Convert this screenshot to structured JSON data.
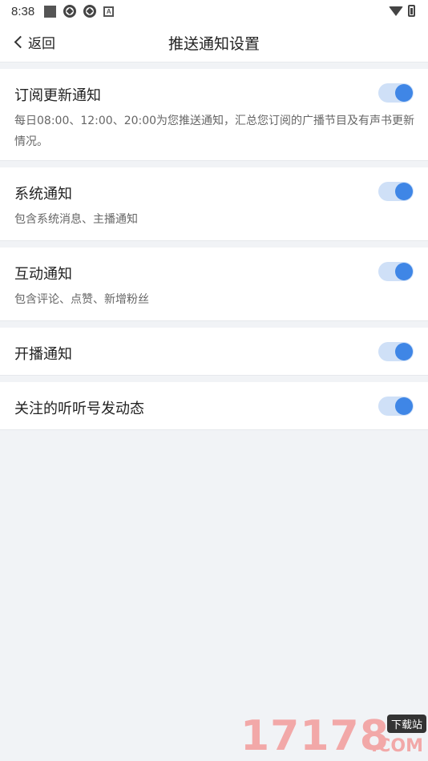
{
  "status_bar": {
    "time": "8:38",
    "icons": [
      "square-notification-icon",
      "sync-icon",
      "sync-icon",
      "font-a-icon",
      "wifi-icon",
      "battery-charging-icon"
    ]
  },
  "nav": {
    "back_label": "返回",
    "title": "推送通知设置"
  },
  "settings": [
    {
      "title": "订阅更新通知",
      "desc": "每日08:00、12:00、20:00为您推送通知，汇总您订阅的广播节目及有声书更新情况。",
      "enabled": true
    },
    {
      "title": "系统通知",
      "desc": "包含系统消息、主播通知",
      "enabled": true
    },
    {
      "title": "互动通知",
      "desc": "包含评论、点赞、新增粉丝",
      "enabled": true
    },
    {
      "title": "开播通知",
      "desc": "",
      "enabled": true
    },
    {
      "title": "关注的听听号发动态",
      "desc": "",
      "enabled": true
    }
  ],
  "watermark": {
    "number": "17178",
    "tag": "下载站",
    "domain": ".COM"
  },
  "colors": {
    "accent": "#3f86e6",
    "toggle_track": "#cfe0f7",
    "background": "#f1f3f6"
  }
}
